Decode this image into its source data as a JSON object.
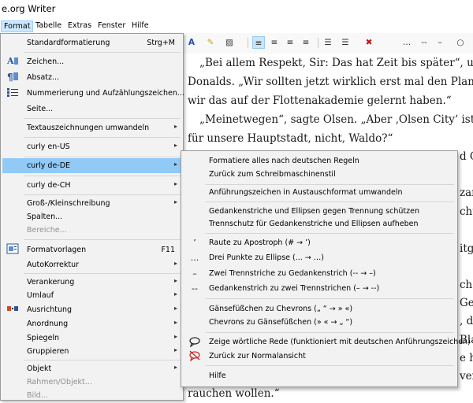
{
  "app": {
    "title": "e.org Writer"
  },
  "menubar": [
    "Format",
    "Tabelle",
    "Extras",
    "Fenster",
    "Hilfe"
  ],
  "document_lines": [
    "„Bei allem Respekt, Sir: Das hat Zeit bis später“, unterbr",
    "Donalds. „Wir sollten jetzt wirklich erst mal den Planeten",
    "wir das auf der Flottenakademie gelernt haben.“",
    "„Meinetwegen“, sagte Olsen. „Aber ‚Olsen City‘ ist doch",
    "für unsere Hauptstadt, nicht, Waldo?“",
    "rauchen wollen.“"
  ],
  "document_fragments": [
    "d C",
    "zar",
    "cht",
    "itgl",
    "ch n",
    "Geg",
    ", di",
    "Blas",
    "e ha",
    "ven"
  ],
  "format_menu": [
    {
      "label": "Standardformatierung",
      "shortcut": "Strg+M",
      "icon": "",
      "submenu": false,
      "disabled": false
    },
    {
      "label": "Zeichen...",
      "shortcut": "",
      "icon": "character-icon",
      "submenu": false,
      "disabled": false
    },
    {
      "label": "Absatz...",
      "shortcut": "",
      "icon": "paragraph-icon",
      "submenu": false,
      "disabled": false
    },
    {
      "label": "Nummerierung und Aufzählungszeichen...",
      "shortcut": "",
      "icon": "bullets-numbering-icon",
      "submenu": false,
      "disabled": false
    },
    {
      "label": "Seite...",
      "shortcut": "",
      "icon": "",
      "submenu": false,
      "disabled": false
    },
    {
      "label": "Textauszeichnungen umwandeln",
      "shortcut": "",
      "icon": "",
      "submenu": true,
      "disabled": false
    },
    {
      "label": "curly en-US",
      "shortcut": "",
      "icon": "",
      "submenu": true,
      "disabled": false
    },
    {
      "label": "curly de-DE",
      "shortcut": "",
      "icon": "",
      "submenu": true,
      "disabled": false,
      "highlighted": true
    },
    {
      "label": "curly de-CH",
      "shortcut": "",
      "icon": "",
      "submenu": true,
      "disabled": false
    },
    {
      "label": "Groß-/Kleinschreibung",
      "shortcut": "",
      "icon": "",
      "submenu": true,
      "disabled": false
    },
    {
      "label": "Spalten...",
      "shortcut": "",
      "icon": "",
      "submenu": false,
      "disabled": false
    },
    {
      "label": "Bereiche...",
      "shortcut": "",
      "icon": "",
      "submenu": false,
      "disabled": true
    },
    {
      "label": "Formatvorlagen",
      "shortcut": "F11",
      "icon": "styles-icon",
      "submenu": false,
      "disabled": false
    },
    {
      "label": "AutoKorrektur",
      "shortcut": "",
      "icon": "",
      "submenu": true,
      "disabled": false
    },
    {
      "label": "Verankerung",
      "shortcut": "",
      "icon": "",
      "submenu": true,
      "disabled": false
    },
    {
      "label": "Umlauf",
      "shortcut": "",
      "icon": "",
      "submenu": true,
      "disabled": false
    },
    {
      "label": "Ausrichtung",
      "shortcut": "",
      "icon": "align-icon",
      "submenu": true,
      "disabled": false
    },
    {
      "label": "Anordnung",
      "shortcut": "",
      "icon": "",
      "submenu": true,
      "disabled": false
    },
    {
      "label": "Spiegeln",
      "shortcut": "",
      "icon": "",
      "submenu": true,
      "disabled": false
    },
    {
      "label": "Gruppieren",
      "shortcut": "",
      "icon": "",
      "submenu": true,
      "disabled": false
    },
    {
      "label": "Objekt",
      "shortcut": "",
      "icon": "",
      "submenu": true,
      "disabled": false
    },
    {
      "label": "Rahmen/Objekt...",
      "shortcut": "",
      "icon": "",
      "submenu": false,
      "disabled": true
    },
    {
      "label": "Bild...",
      "shortcut": "",
      "icon": "",
      "submenu": false,
      "disabled": true
    }
  ],
  "submenu_curly_de": [
    {
      "label": "Formatiere alles nach deutschen Regeln",
      "icon": ""
    },
    {
      "label": "Zurück zum Schreibmaschinenstil",
      "icon": ""
    },
    {
      "label": "Anführungszeichen in Austauschformat umwandeln",
      "icon": ""
    },
    {
      "label": "Gedankenstriche und Ellipsen gegen Trennung schützen",
      "icon": ""
    },
    {
      "label": "Trennschutz für Gedankenstriche und Ellipsen aufheben",
      "icon": ""
    },
    {
      "label": "Raute zu Apostroph (# → ’)",
      "icon": "apostrophe-icon",
      "glyph": "’"
    },
    {
      "label": "Drei Punkte zu Ellipse (... → …)",
      "icon": "ellipsis-icon",
      "glyph": "..."
    },
    {
      "label": "Zwei Trennstriche zu Gedankenstrich (-- → –)",
      "icon": "en-dash-icon",
      "glyph": "–"
    },
    {
      "label": "Gedankenstrich zu zwei Trennstrichen (– → --)",
      "icon": "double-hyphen-icon",
      "glyph": "--"
    },
    {
      "label": "Gänsefüßchen zu Chevrons („ “ → » «)",
      "icon": ""
    },
    {
      "label": "Chevrons zu Gänsefüßchen (» « → „ “)",
      "icon": ""
    },
    {
      "label": "Zeige wörtliche Rede (funktioniert mit deutschen Anführungszeichen)",
      "icon": "speech-bubble-icon",
      "glyph": "🗨"
    },
    {
      "label": "Zurück zur Normalansicht",
      "icon": "speech-bubble-crossed-icon",
      "glyph": "⊘"
    },
    {
      "label": "Hilfe",
      "icon": ""
    }
  ],
  "toolbar_glyphs": [
    "A",
    "✎",
    "▨",
    "≡",
    "≡",
    "≡",
    "≡",
    "☰",
    "☰",
    "✖",
    "…",
    "--",
    "–",
    "○"
  ]
}
